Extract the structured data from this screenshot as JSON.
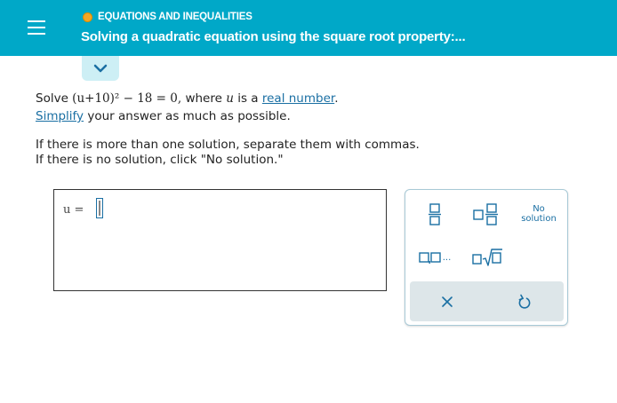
{
  "header": {
    "topic": "EQUATIONS AND INEQUALITIES",
    "title": "Solving a quadratic equation using the square root property:..."
  },
  "problem": {
    "prefix": "Solve",
    "equation_expr": "(u+10)² − 18 = 0,",
    "where_text": "where",
    "variable": "u",
    "is_a_text": "is a",
    "real_number_link": "real number",
    "period": ".",
    "simplify_link": "Simplify",
    "simplify_rest": "your answer as much as possible."
  },
  "instructions": {
    "line1": "If there is more than one solution, separate them with commas.",
    "line2": "If there is no solution, click \"No solution.\""
  },
  "answer": {
    "label": "u  =",
    "value": ""
  },
  "keypad": {
    "no_solution_line1": "No",
    "no_solution_line2": "solution",
    "list_ellipsis": "...",
    "colors": {
      "accent": "#1a6fa3",
      "header": "#00a8c8"
    }
  }
}
